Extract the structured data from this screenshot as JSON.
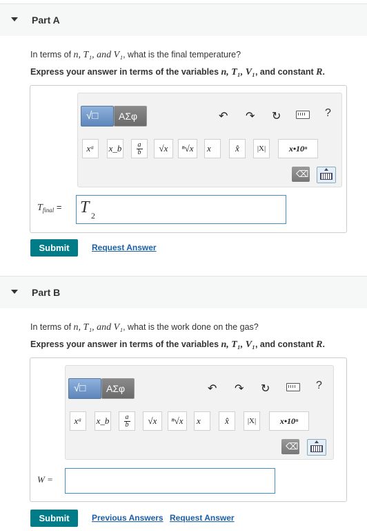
{
  "partA": {
    "title": "Part A",
    "question_pre": "In terms of ",
    "question_vars": "n, T₁, and V₁",
    "question_post": ", what is the final temperature?",
    "instruction_pre": "Express your answer in terms of the variables ",
    "instruction_vars": "n, T₁, V₁",
    "instruction_mid": ", and constant ",
    "instruction_const": "R",
    "instruction_end": ".",
    "answer_label_main": "T",
    "answer_label_sub": "final",
    "answer_eq": " =",
    "answer_value_main": "T",
    "answer_value_sub": "2",
    "submit_label": "Submit",
    "request_label": "Request Answer"
  },
  "partB": {
    "title": "Part B",
    "question_pre": "In terms of ",
    "question_vars": "n, T₁, and V₁",
    "question_post": ", what is the work done on the gas?",
    "instruction_pre": "Express your answer in terms of the variables ",
    "instruction_vars": "n, T₁, V₁",
    "instruction_mid": ", and constant ",
    "instruction_const": "R",
    "instruction_end": ".",
    "answer_label": "W =",
    "submit_label": "Submit",
    "previous_label": "Previous Answers",
    "request_label": "Request Answer"
  },
  "toolbar": {
    "templates_label": "√□",
    "symbols_label": "ΑΣφ",
    "undo_icon": "undo-icon",
    "redo_icon": "redo-icon",
    "reset_icon": "reset-icon",
    "keyboard_icon": "keyboard-icon",
    "help_label": "?",
    "buttons": {
      "superscript": "xᵃ",
      "subscript": "x_b",
      "fraction_num": "a",
      "fraction_den": "b",
      "sqrt": "√x",
      "nthroot": "ⁿ√x",
      "vector": "x⃗",
      "hat": "x̂",
      "abs": "|X|",
      "sci": "x•10ⁿ"
    }
  }
}
